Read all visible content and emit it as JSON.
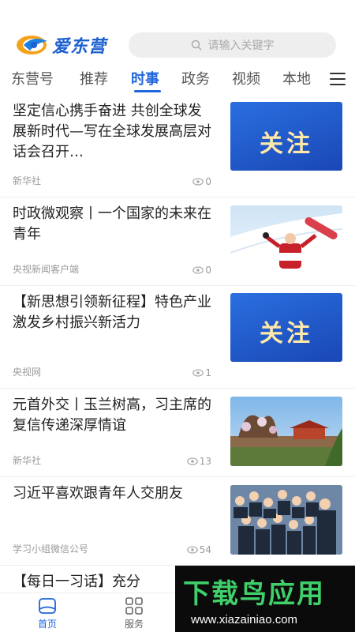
{
  "header": {
    "logo_text": "爱东营",
    "search_placeholder": "请输入关键字"
  },
  "tabs": [
    {
      "label": "东营号"
    },
    {
      "label": "推荐"
    },
    {
      "label": "时事",
      "active": true
    },
    {
      "label": "政务"
    },
    {
      "label": "视频"
    },
    {
      "label": "本地"
    }
  ],
  "feed": [
    {
      "title": "坚定信心携手奋进 共创全球发展新时代—写在全球发展高层对话会召开…",
      "source": "新华社",
      "views": "0",
      "thumb": "关注"
    },
    {
      "title": "时政微观察丨一个国家的未来在青年",
      "source": "央视新闻客户端",
      "views": "0",
      "thumb": "athlete"
    },
    {
      "title": "【新思想引领新征程】特色产业激发乡村振兴新活力",
      "source": "央视网",
      "views": "1",
      "thumb": "关注"
    },
    {
      "title": "元首外交丨玉兰树高，习主席的复信传递深厚情谊",
      "source": "新华社",
      "views": "13",
      "thumb": "garden"
    },
    {
      "title": "习近平喜欢跟青年人交朋友",
      "source": "学习小组微信公号",
      "views": "54",
      "thumb": "crowd"
    },
    {
      "title": "【每日一习话】充分"
    }
  ],
  "bottom_nav": [
    {
      "label": "首页",
      "active": true
    },
    {
      "label": "服务"
    }
  ],
  "watermark": {
    "title": "下载鸟应用",
    "url": "www.xiazainiao.com"
  },
  "colors": {
    "accent": "#1e64dc",
    "focus_bg": "#1f58c9"
  }
}
